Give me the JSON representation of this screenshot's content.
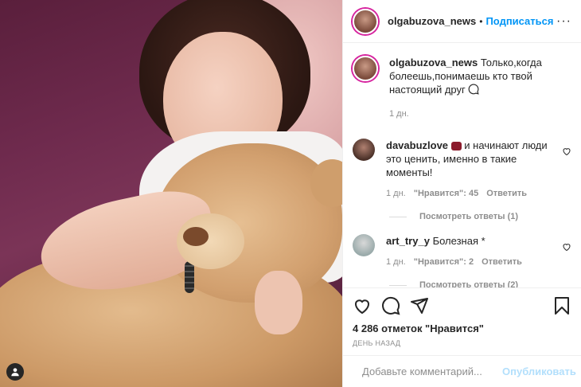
{
  "header": {
    "username": "olgabuzova_news",
    "separator": "•",
    "follow_label": "Подписаться",
    "more_label": "···"
  },
  "caption": {
    "username": "olgabuzova_news",
    "text": "Только,когда болеешь,понимаешь кто твой настоящий друг",
    "date": "1 дн."
  },
  "comments": [
    {
      "username": "davabuzlove",
      "text": "и начинают люди это ценить, именно в такие моменты!",
      "date": "1 дн.",
      "likes": "\"Нравится\": 45",
      "reply_label": "Ответить",
      "view_replies": "Посмотреть ответы (1)"
    },
    {
      "username": "art_try_y",
      "text": "Болезная *",
      "date": "1 дн.",
      "likes": "\"Нравится\": 2",
      "reply_label": "Ответить",
      "view_replies": "Посмотреть ответы (2)"
    }
  ],
  "partial_comment": {
    "username": "",
    "text": ""
  },
  "likes_text": "4 286 отметок \"Нравится\"",
  "time_text": "ДЕНЬ НАЗАД",
  "add_comment": {
    "placeholder": "Добавьте комментарий...",
    "publish_label": "Опубликовать"
  },
  "colors": {
    "accent": "#0095f6",
    "publish_disabled": "#b2dffc",
    "muted": "#8e8e8e"
  },
  "icons": {
    "like": "heart-icon",
    "comment": "comment-icon",
    "share": "paper-plane-icon",
    "save": "bookmark-icon",
    "emoji": "smiley-icon",
    "more": "more-dots-icon",
    "tagged": "user-tag-icon"
  }
}
